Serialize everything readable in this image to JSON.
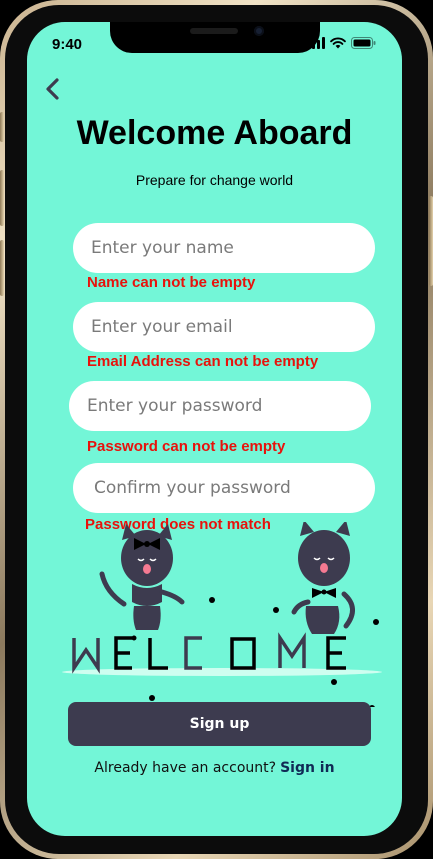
{
  "status_bar": {
    "time": "9:40",
    "icons": [
      "signal-icon",
      "wifi-icon",
      "battery-icon"
    ]
  },
  "header": {
    "back_icon": "chevron-left-icon",
    "title": "Welcome Aboard",
    "subtitle": "Prepare for change world"
  },
  "form": {
    "name": {
      "placeholder": "Enter your name",
      "value": "",
      "error": "Name can not be empty"
    },
    "email": {
      "placeholder": "Enter your email",
      "value": "",
      "error": "Email Address can not be empty"
    },
    "password": {
      "placeholder": "Enter your password",
      "value": "",
      "error": "Password can not be empty"
    },
    "confirm_password": {
      "placeholder": "Confirm your password",
      "value": "",
      "error": "Password does not match"
    }
  },
  "illustration": {
    "word": "WELCOME",
    "description_icon": "welcome-cats-illustration"
  },
  "signup_button": {
    "label": "Sign up"
  },
  "signin": {
    "prompt": "Already have an account?",
    "link": "Sign in"
  },
  "colors": {
    "background": "#73f6d7",
    "button": "#3d3b4f",
    "error": "#e8120c",
    "link": "#102a55"
  }
}
